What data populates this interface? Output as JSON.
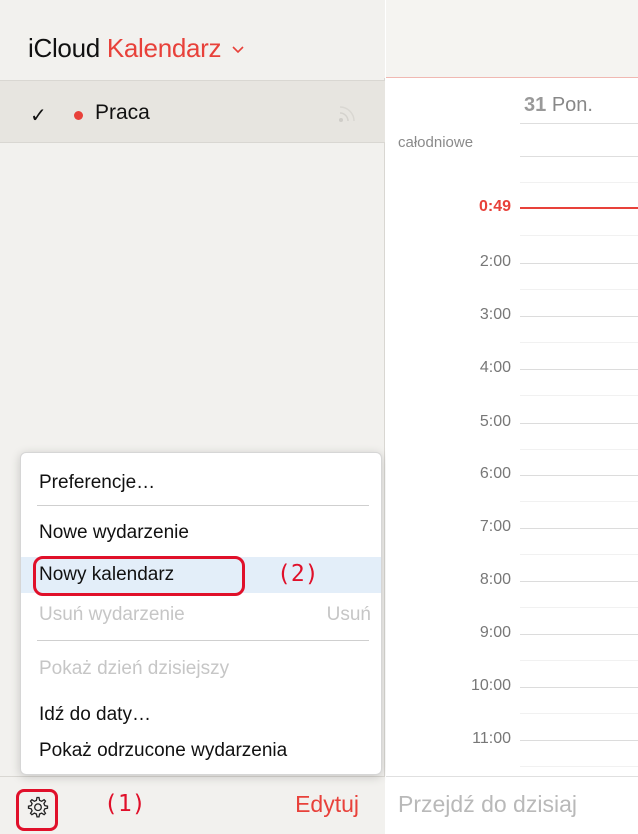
{
  "header": {
    "brand": "iCloud",
    "app_name": "Kalendarz"
  },
  "calendars": [
    {
      "checked": true,
      "name": "Praca",
      "color": "#e8413a"
    }
  ],
  "footer": {
    "edit_label": "Edytuj",
    "step1": "(1)"
  },
  "menu": {
    "items": [
      {
        "label": "Preferencje…",
        "enabled": true
      },
      {
        "label": "Nowe wydarzenie",
        "enabled": true
      },
      {
        "label": "Nowy kalendarz",
        "enabled": true,
        "highlighted": true
      },
      {
        "label": "Usuń wydarzenie",
        "shortcut": "Usuń",
        "enabled": false
      },
      {
        "label": "Pokaż dzień dzisiejszy",
        "enabled": false
      },
      {
        "label": "Idź do daty…",
        "enabled": true
      },
      {
        "label": "Pokaż odrzucone wydarzenia",
        "enabled": true
      }
    ],
    "step2": "(2)"
  },
  "day_view": {
    "day_number": "31",
    "day_name": "Pon.",
    "allday_label": "całodniowe",
    "current_time": "0:49",
    "hours": [
      "2:00",
      "3:00",
      "4:00",
      "5:00",
      "6:00",
      "7:00",
      "8:00",
      "9:00",
      "10:00",
      "11:00"
    ],
    "today_button": "Przejdź do dzisiaj"
  },
  "colors": {
    "accent": "#e8413a",
    "annotation": "#e0102a",
    "sidebar_bg": "#f2f1ee"
  }
}
